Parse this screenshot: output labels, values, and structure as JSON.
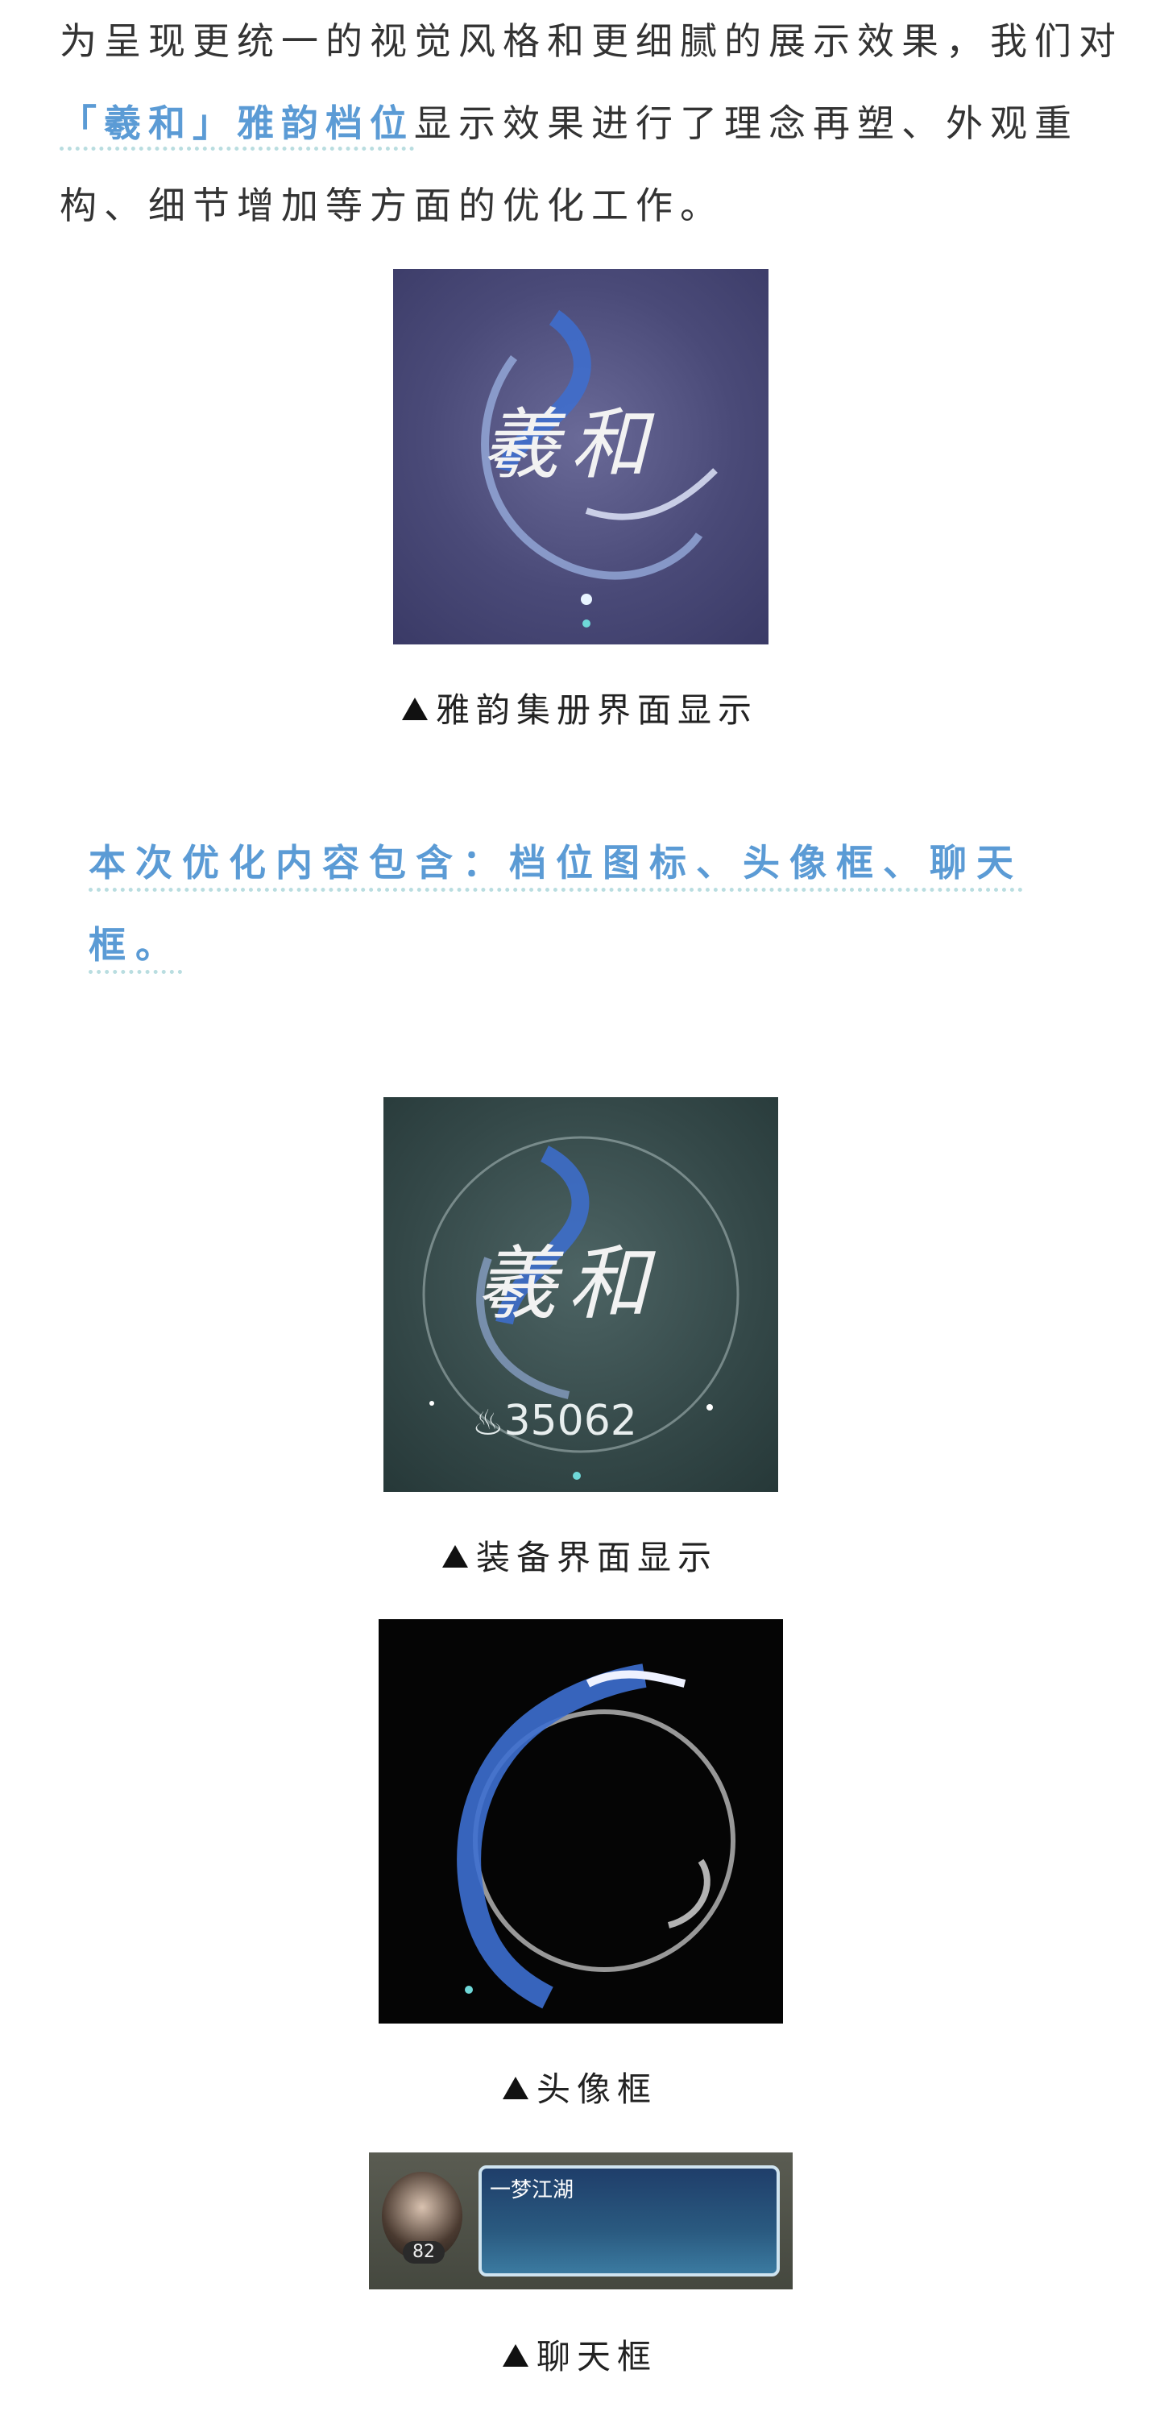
{
  "intro": {
    "text1": "为呈现更统一的视觉风格和更细腻的展示效果，我们对",
    "highlight": "「羲和」雅韵档位",
    "text2": "显示效果进行了理念再塑、外观重构、细节增加等方面的优化工作。"
  },
  "images": {
    "collection": {
      "glyph": "羲和",
      "caption": "雅韵集册界面显示"
    },
    "equipment": {
      "glyph": "羲和",
      "score": "35062",
      "caption": "装备界面显示"
    },
    "avatar_frame": {
      "caption": "头像框"
    },
    "chat_frame": {
      "level": "82",
      "name": "一梦江湖",
      "caption": "聊天框"
    }
  },
  "summary": "本次优化内容包含：档位图标、头像框、聊天框。",
  "colors": {
    "accent": "#5b9bd5",
    "underline": "#b9dde0",
    "collection_bg": "#4a4a78",
    "equipment_bg": "#344848",
    "frame_bg": "#050505",
    "chat_bg": "#4a4d45"
  }
}
